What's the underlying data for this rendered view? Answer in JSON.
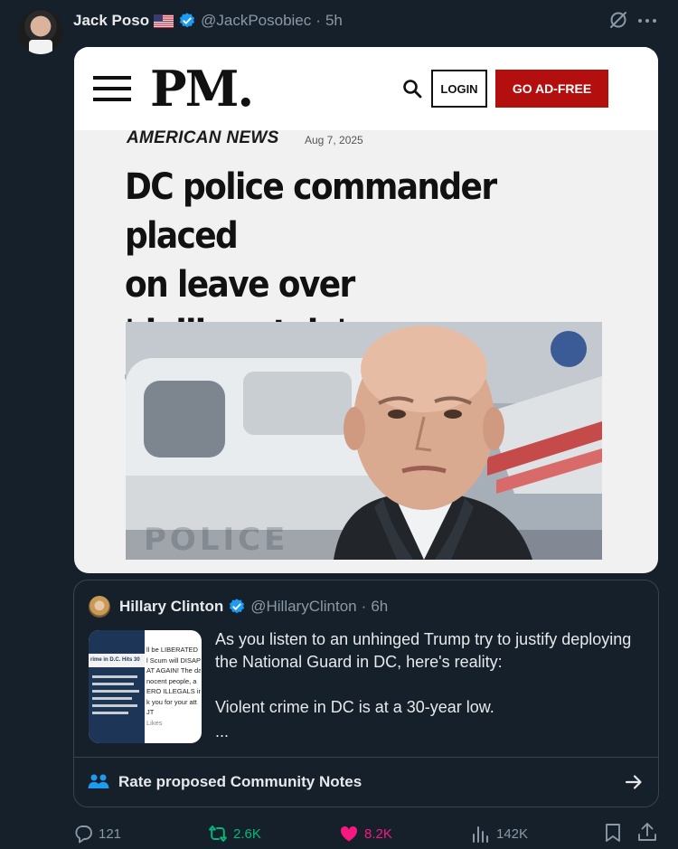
{
  "tweet": {
    "author_name": "Jack Poso",
    "flag": "🇺🇸",
    "handle": "@JackPosobiec",
    "separator": "·",
    "time": "5h"
  },
  "article": {
    "logo": "PM.",
    "login_label": "LOGIN",
    "adfree_label": "GO AD-FREE",
    "section": "AMERICAN NEWS",
    "date": "Aug 7, 2025",
    "headline": "DC police commander placed\non leave over 'deliberately'\nfalsifying crime data",
    "photo_vehicle_text": "POLICE"
  },
  "quote": {
    "author_name": "Hillary Clinton",
    "handle": "@HillaryClinton",
    "separator": "·",
    "time": "6h",
    "text": "As you listen to an unhinged Trump try to justify deploying the National Guard in DC, here's reality:\n\nViolent crime in DC is at a 30-year low.",
    "ellipsis": "...",
    "thumbnail_text": {
      "left_headline": "rime in D.C. Hits 30",
      "right_lines": [
        "ll be LIBERATED",
        "l Scum will DISAP",
        "AT AGAIN! The da",
        "nocent people, a",
        "ERO ILLEGALS in",
        "k you for your att",
        "JT"
      ],
      "likes": "Likes"
    },
    "community_notes_label": "Rate proposed Community Notes"
  },
  "actions": {
    "replies": "121",
    "reposts": "2.6K",
    "likes": "8.2K",
    "views": "142K"
  },
  "colors": {
    "background": "#15202b",
    "verified": "#1d9bf0",
    "repost": "#00ba7c",
    "like": "#f91880",
    "adfree_button": "#b40f0f"
  },
  "icons": [
    "grok-icon",
    "more-icon",
    "menu-icon",
    "search-icon",
    "people-icon",
    "arrow-right-icon",
    "reply-icon",
    "repost-icon",
    "heart-icon",
    "views-icon",
    "bookmark-icon",
    "share-icon"
  ]
}
